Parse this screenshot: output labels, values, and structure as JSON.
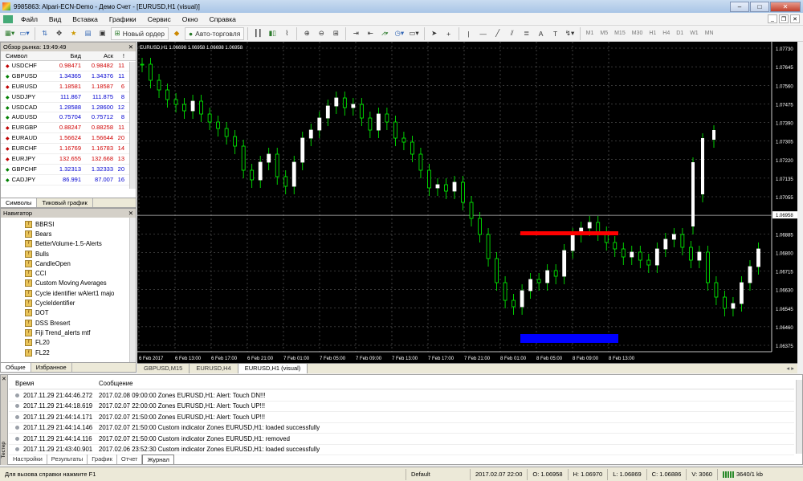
{
  "window": {
    "title": "9985863: Alpari-ECN-Demo - Демо Счет - [EURUSD,H1 (visual)]",
    "min": "–",
    "max": "□",
    "close": "✕"
  },
  "menu": [
    "Файл",
    "Вид",
    "Вставка",
    "Графики",
    "Сервис",
    "Окно",
    "Справка"
  ],
  "toolbar": {
    "new_order": "Новый ордер",
    "autotrading": "Авто-торговля",
    "timeframes": [
      "M1",
      "M5",
      "M15",
      "M30",
      "H1",
      "H4",
      "D1",
      "W1",
      "MN"
    ]
  },
  "market_watch": {
    "title": "Обзор рынка: 19:49:49",
    "headers": [
      "Символ",
      "Бид",
      "Аск",
      "!"
    ],
    "rows": [
      {
        "symbol": "USDCHF",
        "bid": "0.98471",
        "ask": "0.98482",
        "spread": "11",
        "dir": "down"
      },
      {
        "symbol": "GBPUSD",
        "bid": "1.34365",
        "ask": "1.34376",
        "spread": "11",
        "dir": "up"
      },
      {
        "symbol": "EURUSD",
        "bid": "1.18581",
        "ask": "1.18587",
        "spread": "6",
        "dir": "down"
      },
      {
        "symbol": "USDJPY",
        "bid": "111.867",
        "ask": "111.875",
        "spread": "8",
        "dir": "up"
      },
      {
        "symbol": "USDCAD",
        "bid": "1.28588",
        "ask": "1.28600",
        "spread": "12",
        "dir": "up"
      },
      {
        "symbol": "AUDUSD",
        "bid": "0.75704",
        "ask": "0.75712",
        "spread": "8",
        "dir": "up"
      },
      {
        "symbol": "EURGBP",
        "bid": "0.88247",
        "ask": "0.88258",
        "spread": "11",
        "dir": "down"
      },
      {
        "symbol": "EURAUD",
        "bid": "1.56624",
        "ask": "1.56644",
        "spread": "20",
        "dir": "down"
      },
      {
        "symbol": "EURCHF",
        "bid": "1.16769",
        "ask": "1.16783",
        "spread": "14",
        "dir": "down"
      },
      {
        "symbol": "EURJPY",
        "bid": "132.655",
        "ask": "132.668",
        "spread": "13",
        "dir": "down"
      },
      {
        "symbol": "GBPCHF",
        "bid": "1.32313",
        "ask": "1.32333",
        "spread": "20",
        "dir": "up"
      },
      {
        "symbol": "CADJPY",
        "bid": "86.991",
        "ask": "87.007",
        "spread": "16",
        "dir": "up"
      }
    ],
    "tabs": [
      "Символы",
      "Тиковый график"
    ]
  },
  "navigator": {
    "title": "Навигатор",
    "items": [
      "BBRSI",
      "Bears",
      "BetterVolume-1.5-Alerts",
      "Bulls",
      "CandleOpen",
      "CCI",
      "Custom Moving Averages",
      "Cycle identifier wAlert1 majo",
      "CycleIdentifier",
      "DOT",
      "DSS Bresert",
      "Fiji Trend_alerts mtf",
      "FL20",
      "FL22"
    ],
    "tabs": [
      "Общие",
      "Избранное"
    ]
  },
  "chart": {
    "info": "EURUSD,H1  1.06698 1.06958 1.06698 1.06958",
    "price_labels": [
      "1.07730",
      "1.07645",
      "1.07560",
      "1.07475",
      "1.07390",
      "1.07305",
      "1.07220",
      "1.07135",
      "1.07055",
      "1.06958",
      "1.06885",
      "1.06800",
      "1.06715",
      "1.06630",
      "1.06545",
      "1.06460",
      "1.06375"
    ],
    "current_price": "1.06958",
    "time_labels": [
      "6 Feb 2017",
      "6 Feb 13:00",
      "6 Feb 17:00",
      "6 Feb 21:00",
      "7 Feb 01:00",
      "7 Feb 05:00",
      "7 Feb 09:00",
      "7 Feb 13:00",
      "7 Feb 17:00",
      "7 Feb 21:00",
      "8 Feb 01:00",
      "8 Feb 05:00",
      "8 Feb 09:00",
      "8 Feb 13:00"
    ],
    "colors": {
      "bg": "#000000",
      "bull": "#ffffff",
      "bear": "#00ff00",
      "grid": "#6b6b6b",
      "axis": "#ffffff",
      "zone_top": "#ff0000",
      "zone_bottom": "#0000ff"
    }
  },
  "chart_tabs": [
    "GBPUSD,M15",
    "EURUSD,H4",
    "EURUSD,H1 (visual)"
  ],
  "terminal": {
    "side_label": "Тестер",
    "headers": [
      "Время",
      "Сообщение"
    ],
    "rows": [
      {
        "time": "2017.11.29 21:44:46.272",
        "msg": "2017.02.08 09:00:00  Zones EURUSD,H1: Alert: Touch DN!!!"
      },
      {
        "time": "2017.11.29 21:44:18.619",
        "msg": "2017.02.07 22:00:00  Zones EURUSD,H1: Alert: Touch UP!!!"
      },
      {
        "time": "2017.11.29 21:44:14.171",
        "msg": "2017.02.07 21:50:00  Zones EURUSD,H1: Alert: Touch UP!!!"
      },
      {
        "time": "2017.11.29 21:44:14.146",
        "msg": "2017.02.07 21:50:00  Custom indicator Zones EURUSD,H1: loaded successfully"
      },
      {
        "time": "2017.11.29 21:44:14.116",
        "msg": "2017.02.07 21:50:00  Custom indicator Zones EURUSD,H1: removed"
      },
      {
        "time": "2017.11.29 21:43:40.901",
        "msg": "2017.02.06 23:52:30  Custom indicator Zones EURUSD,H1: loaded successfully"
      }
    ],
    "tabs": [
      "Настройки",
      "Результаты",
      "График",
      "Отчет",
      "Журнал"
    ]
  },
  "status": {
    "help": "Для вызова справки нажмите F1",
    "profile": "Default",
    "datetime": "2017.02.07 22:00",
    "open": "O: 1.06958",
    "high": "H: 1.06970",
    "low": "L: 1.06869",
    "closep": "C: 1.06886",
    "volume": "V: 3060",
    "traffic": "3640/1 kb"
  }
}
